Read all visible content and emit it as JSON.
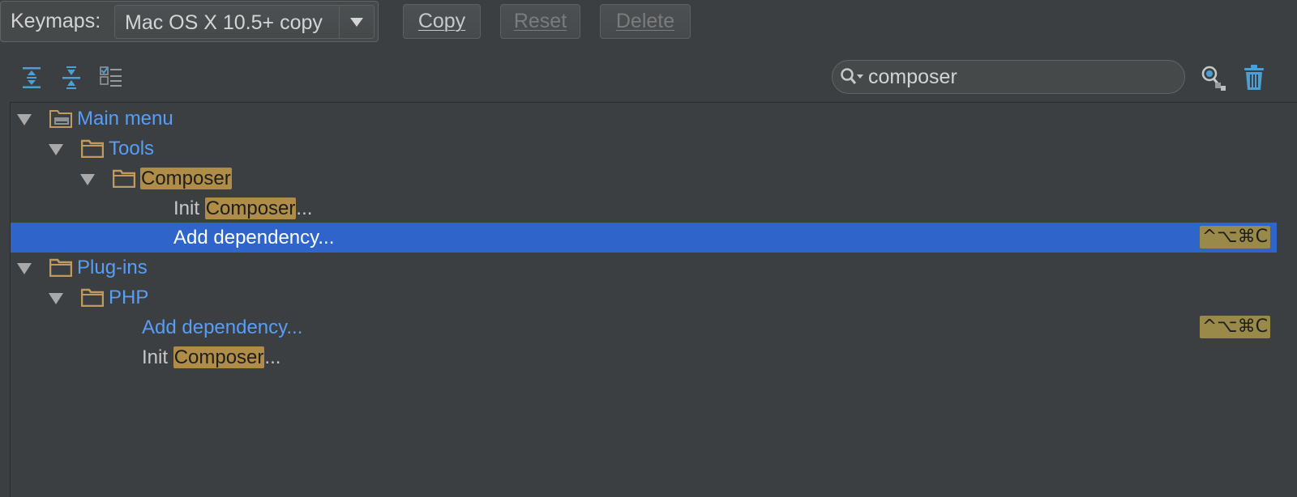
{
  "header": {
    "keymaps_label": "Keymaps:",
    "selected_keymap": "Mac OS X 10.5+ copy",
    "copy_label": "Copy",
    "reset_label": "Reset",
    "delete_label": "Delete"
  },
  "toolbar": {
    "icons": [
      "expand-all-icon",
      "collapse-all-icon",
      "checklist-icon",
      "search-icon",
      "find-shortcut-icon",
      "trash-icon"
    ]
  },
  "search": {
    "value": "composer"
  },
  "tree": {
    "main_menu": "Main menu",
    "tools": "Tools",
    "composer_group": "Composer",
    "init_prefix": "Init ",
    "init_highlight": "Composer",
    "init_suffix": "...",
    "add_dependency": "Add dependency...",
    "add_dependency_shortcut": "^⌥⌘C",
    "plugins": "Plug-ins",
    "php": "PHP",
    "php_add_dependency": "Add dependency...",
    "php_add_dependency_shortcut": "^⌥⌘C",
    "php_init_prefix": "Init ",
    "php_init_highlight": "Composer",
    "php_init_suffix": "..."
  },
  "colors": {
    "background": "#3c3f41",
    "selection": "#2f65ca",
    "group_text": "#589df6",
    "match_highlight": "#b08d47",
    "folder": "#c09a5e"
  }
}
